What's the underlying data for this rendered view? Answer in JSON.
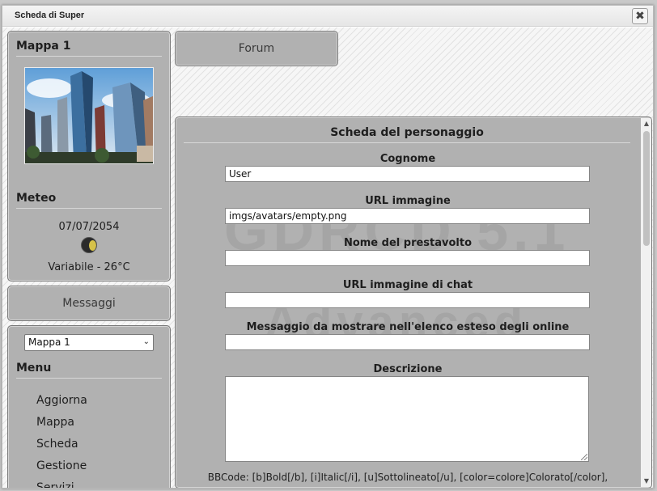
{
  "window": {
    "title": "Scheda di Super",
    "close_symbol": "✖"
  },
  "map_panel": {
    "heading": "Mappa 1"
  },
  "weather": {
    "heading": "Meteo",
    "date": "07/07/2054",
    "condition": "Variabile - 26°C"
  },
  "messages": {
    "label": "Messaggi"
  },
  "menu_panel": {
    "select_value": "Mappa 1",
    "heading": "Menu",
    "items": [
      "Aggiorna",
      "Mappa",
      "Scheda",
      "Gestione",
      "Servizi"
    ]
  },
  "forum": {
    "label": "Forum"
  },
  "sheet": {
    "title": "Scheda del personaggio",
    "fields": [
      {
        "label": "Cognome",
        "value": "User"
      },
      {
        "label": "URL immagine",
        "value": "imgs/avatars/empty.png"
      },
      {
        "label": "Nome del prestavolto",
        "value": ""
      },
      {
        "label": "URL immagine di chat",
        "value": ""
      },
      {
        "label": "Messaggio da mostrare nell'elenco esteso degli online",
        "value": ""
      }
    ],
    "description_label": "Descrizione",
    "bbcode_help": "BBCode: [b]Bold[/b], [i]Italic[/i], [u]Sottolineato[/u], [color=colore]Colorato[/color],"
  },
  "icons": {
    "close": "close-icon",
    "moon": "moon-phase-icon",
    "chevron": "chevron-down-icon"
  }
}
